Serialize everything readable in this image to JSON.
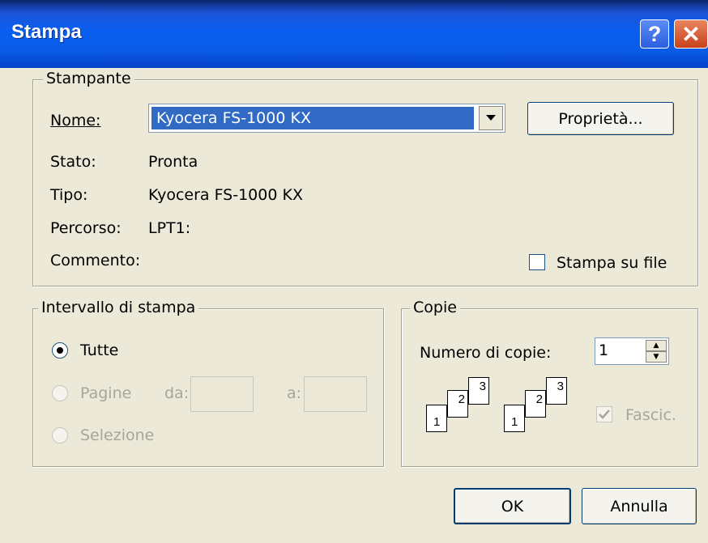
{
  "window": {
    "title": "Stampa",
    "help_glyph": "?",
    "close_glyph": "✕"
  },
  "printer": {
    "group_label": "Stampante",
    "name_label": "Nome:",
    "name_value": "Kyocera FS-1000 KX",
    "properties_button": "Proprietà...",
    "status_label": "Stato:",
    "status_value": "Pronta",
    "type_label": "Tipo:",
    "type_value": "Kyocera FS-1000 KX",
    "path_label": "Percorso:",
    "path_value": "LPT1:",
    "comment_label": "Commento:",
    "print_to_file_label": "Stampa su file",
    "print_to_file_checked": false
  },
  "range": {
    "group_label": "Intervallo di stampa",
    "all_label": "Tutte",
    "pages_label": "Pagine",
    "from_label": "da:",
    "to_label": "a:",
    "selection_label": "Selezione",
    "selected": "Tutte"
  },
  "copies": {
    "group_label": "Copie",
    "count_label": "Numero di copie:",
    "count_value": "1",
    "collate_label": "Fascic.",
    "collate_checked": true,
    "collate_page_numbers": [
      "1",
      "2",
      "3"
    ]
  },
  "buttons": {
    "ok": "OK",
    "cancel": "Annulla"
  },
  "colors": {
    "titlebar": "#0A5AE8",
    "dialog_bg": "#ECE9D8",
    "selection": "#316AC5",
    "close_button": "#C8421C"
  }
}
